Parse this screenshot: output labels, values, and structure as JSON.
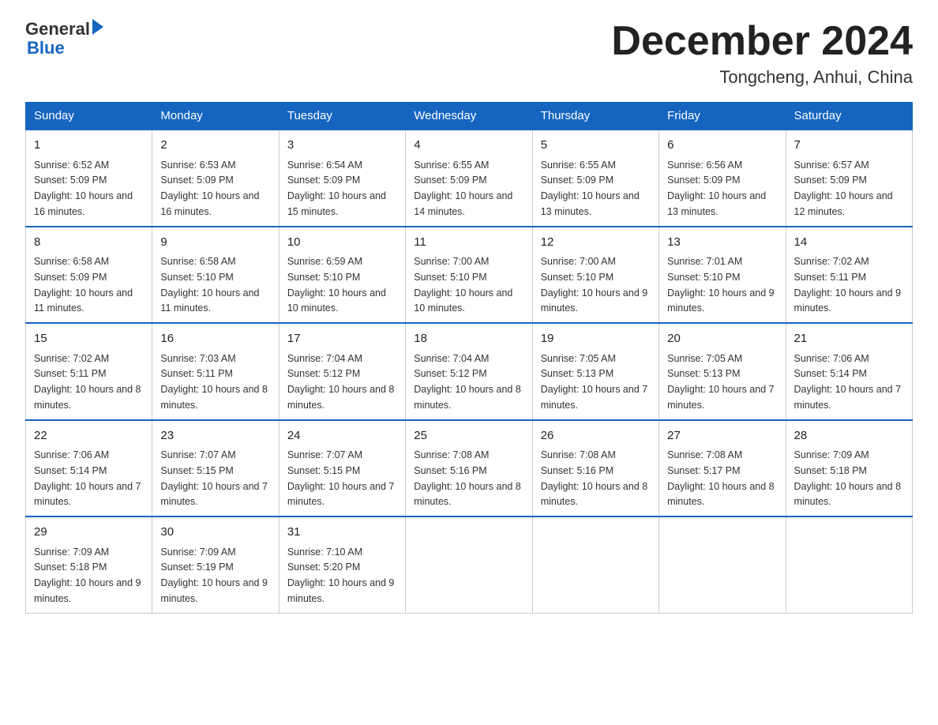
{
  "logo": {
    "general": "General",
    "blue": "Blue",
    "arrow": "▶"
  },
  "title": "December 2024",
  "location": "Tongcheng, Anhui, China",
  "days_of_week": [
    "Sunday",
    "Monday",
    "Tuesday",
    "Wednesday",
    "Thursday",
    "Friday",
    "Saturday"
  ],
  "weeks": [
    [
      {
        "day": "1",
        "sunrise": "6:52 AM",
        "sunset": "5:09 PM",
        "daylight": "10 hours and 16 minutes."
      },
      {
        "day": "2",
        "sunrise": "6:53 AM",
        "sunset": "5:09 PM",
        "daylight": "10 hours and 16 minutes."
      },
      {
        "day": "3",
        "sunrise": "6:54 AM",
        "sunset": "5:09 PM",
        "daylight": "10 hours and 15 minutes."
      },
      {
        "day": "4",
        "sunrise": "6:55 AM",
        "sunset": "5:09 PM",
        "daylight": "10 hours and 14 minutes."
      },
      {
        "day": "5",
        "sunrise": "6:55 AM",
        "sunset": "5:09 PM",
        "daylight": "10 hours and 13 minutes."
      },
      {
        "day": "6",
        "sunrise": "6:56 AM",
        "sunset": "5:09 PM",
        "daylight": "10 hours and 13 minutes."
      },
      {
        "day": "7",
        "sunrise": "6:57 AM",
        "sunset": "5:09 PM",
        "daylight": "10 hours and 12 minutes."
      }
    ],
    [
      {
        "day": "8",
        "sunrise": "6:58 AM",
        "sunset": "5:09 PM",
        "daylight": "10 hours and 11 minutes."
      },
      {
        "day": "9",
        "sunrise": "6:58 AM",
        "sunset": "5:10 PM",
        "daylight": "10 hours and 11 minutes."
      },
      {
        "day": "10",
        "sunrise": "6:59 AM",
        "sunset": "5:10 PM",
        "daylight": "10 hours and 10 minutes."
      },
      {
        "day": "11",
        "sunrise": "7:00 AM",
        "sunset": "5:10 PM",
        "daylight": "10 hours and 10 minutes."
      },
      {
        "day": "12",
        "sunrise": "7:00 AM",
        "sunset": "5:10 PM",
        "daylight": "10 hours and 9 minutes."
      },
      {
        "day": "13",
        "sunrise": "7:01 AM",
        "sunset": "5:10 PM",
        "daylight": "10 hours and 9 minutes."
      },
      {
        "day": "14",
        "sunrise": "7:02 AM",
        "sunset": "5:11 PM",
        "daylight": "10 hours and 9 minutes."
      }
    ],
    [
      {
        "day": "15",
        "sunrise": "7:02 AM",
        "sunset": "5:11 PM",
        "daylight": "10 hours and 8 minutes."
      },
      {
        "day": "16",
        "sunrise": "7:03 AM",
        "sunset": "5:11 PM",
        "daylight": "10 hours and 8 minutes."
      },
      {
        "day": "17",
        "sunrise": "7:04 AM",
        "sunset": "5:12 PM",
        "daylight": "10 hours and 8 minutes."
      },
      {
        "day": "18",
        "sunrise": "7:04 AM",
        "sunset": "5:12 PM",
        "daylight": "10 hours and 8 minutes."
      },
      {
        "day": "19",
        "sunrise": "7:05 AM",
        "sunset": "5:13 PM",
        "daylight": "10 hours and 7 minutes."
      },
      {
        "day": "20",
        "sunrise": "7:05 AM",
        "sunset": "5:13 PM",
        "daylight": "10 hours and 7 minutes."
      },
      {
        "day": "21",
        "sunrise": "7:06 AM",
        "sunset": "5:14 PM",
        "daylight": "10 hours and 7 minutes."
      }
    ],
    [
      {
        "day": "22",
        "sunrise": "7:06 AM",
        "sunset": "5:14 PM",
        "daylight": "10 hours and 7 minutes."
      },
      {
        "day": "23",
        "sunrise": "7:07 AM",
        "sunset": "5:15 PM",
        "daylight": "10 hours and 7 minutes."
      },
      {
        "day": "24",
        "sunrise": "7:07 AM",
        "sunset": "5:15 PM",
        "daylight": "10 hours and 7 minutes."
      },
      {
        "day": "25",
        "sunrise": "7:08 AM",
        "sunset": "5:16 PM",
        "daylight": "10 hours and 8 minutes."
      },
      {
        "day": "26",
        "sunrise": "7:08 AM",
        "sunset": "5:16 PM",
        "daylight": "10 hours and 8 minutes."
      },
      {
        "day": "27",
        "sunrise": "7:08 AM",
        "sunset": "5:17 PM",
        "daylight": "10 hours and 8 minutes."
      },
      {
        "day": "28",
        "sunrise": "7:09 AM",
        "sunset": "5:18 PM",
        "daylight": "10 hours and 8 minutes."
      }
    ],
    [
      {
        "day": "29",
        "sunrise": "7:09 AM",
        "sunset": "5:18 PM",
        "daylight": "10 hours and 9 minutes."
      },
      {
        "day": "30",
        "sunrise": "7:09 AM",
        "sunset": "5:19 PM",
        "daylight": "10 hours and 9 minutes."
      },
      {
        "day": "31",
        "sunrise": "7:10 AM",
        "sunset": "5:20 PM",
        "daylight": "10 hours and 9 minutes."
      },
      null,
      null,
      null,
      null
    ]
  ]
}
